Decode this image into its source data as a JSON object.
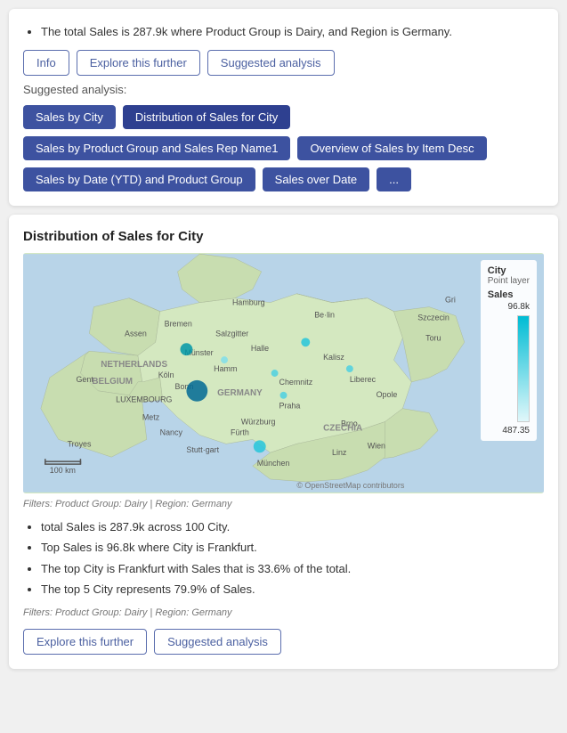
{
  "topPanel": {
    "bullet": "The total Sales is 287.9k where Product Group is Dairy, and Region is Germany.",
    "buttons": {
      "info": "Info",
      "explore": "Explore this further",
      "suggested": "Suggested analysis"
    }
  },
  "suggested": {
    "label": "Suggested analysis:",
    "buttons": {
      "row1": [
        "Sales by City",
        "Distribution of Sales for City"
      ],
      "row2_left": "Sales by Product Group and Sales Rep Name1",
      "row2_right": "Overview of Sales by Item Desc",
      "row3_left": "Sales by Date (YTD) and Product Group",
      "row3_mid": "Sales over Date",
      "row3_more": "..."
    }
  },
  "chartPanel": {
    "title": "Distribution of Sales for City",
    "legend": {
      "title": "City",
      "subtitle": "Point layer",
      "salesLabel": "Sales",
      "max": "96.8k",
      "min": "487.35"
    },
    "filterText": "Filters: Product Group: Dairy | Region: Germany",
    "insights": [
      "total Sales is 287.9k across 100 City.",
      "Top Sales is 96.8k where City is Frankfurt.",
      "The top City is Frankfurt with Sales that is 33.6% of the total.",
      "The top 5 City represents 79.9% of Sales."
    ],
    "filterText2": "Filters: Product Group: Dairy | Region: Germany",
    "bottomButtons": {
      "explore": "Explore this further",
      "suggested": "Suggested analysis"
    },
    "mapAttribution": "© OpenStreetMap contributors"
  }
}
